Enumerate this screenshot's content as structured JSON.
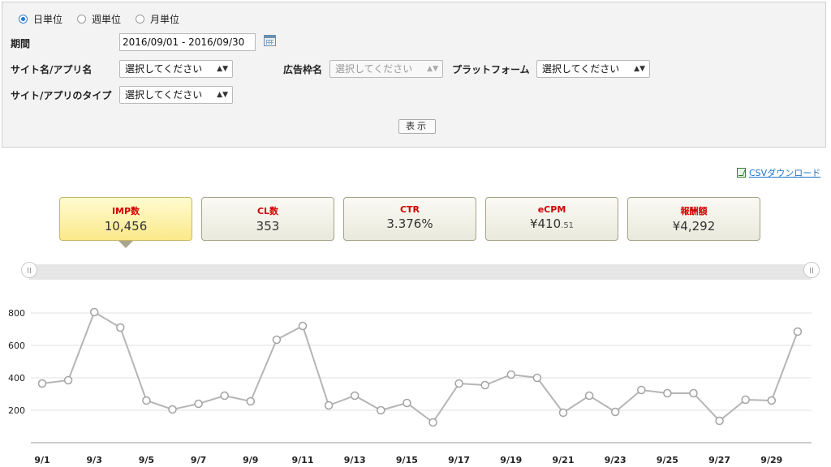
{
  "filters": {
    "units": [
      {
        "label": "日単位",
        "selected": true
      },
      {
        "label": "週単位",
        "selected": false
      },
      {
        "label": "月単位",
        "selected": false
      }
    ],
    "period_label": "期間",
    "period_value": "2016/09/01 - 2016/09/30",
    "site_label": "サイト名/アプリ名",
    "site_value": "選択してください",
    "ad_frame_label": "広告枠名",
    "ad_frame_value": "選択してください",
    "platform_label": "プラットフォーム",
    "platform_value": "選択してください",
    "site_type_label": "サイト/アプリのタイプ",
    "site_type_value": "選択してください",
    "show_button": "表示"
  },
  "csv_link": "CSVダウンロード",
  "metrics": [
    {
      "label": "IMP数",
      "value": "10,456",
      "active": true
    },
    {
      "label": "CL数",
      "value": "353",
      "active": false
    },
    {
      "label": "CTR",
      "value": "3.376%",
      "active": false
    },
    {
      "label": "eCPM",
      "value": "¥410",
      "sub": ".51",
      "active": false
    },
    {
      "label": "報酬額",
      "value": "¥4,292",
      "active": false
    }
  ],
  "colors": {
    "line": "#b5b5b5",
    "metric_label": "#d10000",
    "active_tab": "#fbe98a"
  },
  "chart_data": {
    "type": "line",
    "x": [
      "9/1",
      "9/2",
      "9/3",
      "9/4",
      "9/5",
      "9/6",
      "9/7",
      "9/8",
      "9/9",
      "9/10",
      "9/11",
      "9/12",
      "9/13",
      "9/14",
      "9/15",
      "9/16",
      "9/17",
      "9/18",
      "9/19",
      "9/20",
      "9/21",
      "9/22",
      "9/23",
      "9/24",
      "9/25",
      "9/26",
      "9/27",
      "9/28",
      "9/29",
      "9/30"
    ],
    "x_tick_labels": [
      "9/1",
      "9/3",
      "9/5",
      "9/7",
      "9/9",
      "9/11",
      "9/13",
      "9/15",
      "9/17",
      "9/19",
      "9/21",
      "9/23",
      "9/25",
      "9/27",
      "9/29"
    ],
    "series": [
      {
        "values": [
          365,
          385,
          805,
          710,
          260,
          205,
          240,
          290,
          255,
          635,
          720,
          230,
          290,
          200,
          245,
          125,
          365,
          355,
          420,
          400,
          185,
          290,
          190,
          325,
          305,
          305,
          135,
          265,
          260,
          685
        ]
      }
    ],
    "y_ticks": [
      200,
      400,
      600,
      800
    ],
    "ylim": [
      0,
      880
    ],
    "grid": true,
    "legend": "none"
  }
}
